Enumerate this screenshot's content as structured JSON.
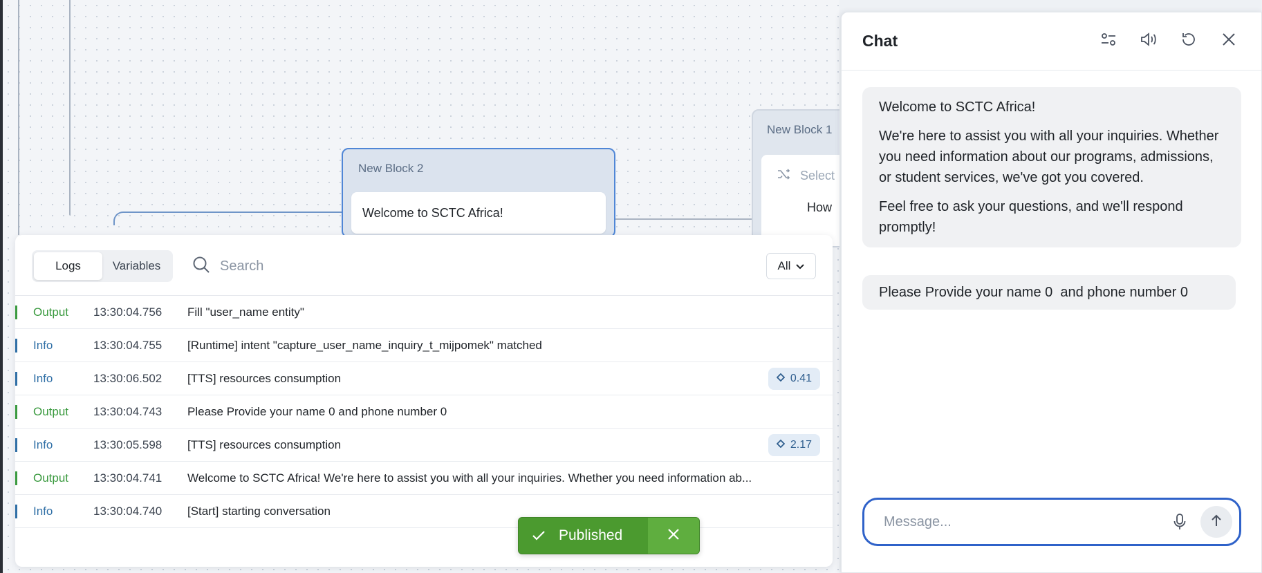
{
  "canvas": {
    "block2": {
      "title": "New Block 2",
      "message": "Welcome to SCTC Africa!"
    },
    "block1": {
      "title": "New Block 1",
      "select_placeholder": "Select",
      "message_start": "How"
    }
  },
  "logs": {
    "tabs": [
      {
        "label": "Logs"
      },
      {
        "label": "Variables"
      }
    ],
    "search_placeholder": "Search",
    "filter_value": "All",
    "rows": [
      {
        "level": "Output",
        "time": "13:30:04.756",
        "message": "Fill \"user_name entity\"",
        "badge": ""
      },
      {
        "level": "Info",
        "time": "13:30:04.755",
        "message": "[Runtime] intent \"capture_user_name_inquiry_t_mijpomek\" matched",
        "badge": ""
      },
      {
        "level": "Info",
        "time": "13:30:06.502",
        "message": "[TTS] resources consumption",
        "badge": "0.41"
      },
      {
        "level": "Output",
        "time": "13:30:04.743",
        "message": "Please Provide your name 0 and phone number 0",
        "badge": ""
      },
      {
        "level": "Info",
        "time": "13:30:05.598",
        "message": "[TTS] resources consumption",
        "badge": "2.17"
      },
      {
        "level": "Output",
        "time": "13:30:04.741",
        "message": "Welcome to SCTC Africa! We're here to assist you with all your inquiries. Whether you need information ab...",
        "badge": ""
      },
      {
        "level": "Info",
        "time": "13:30:04.740",
        "message": "[Start] starting conversation",
        "badge": ""
      }
    ],
    "colors": {
      "output": "#3a9a3f",
      "info": "#2f6fa6"
    }
  },
  "toast": {
    "label": "Published",
    "color": "#4b9a2f"
  },
  "chat": {
    "title": "Chat",
    "icons": [
      "settings-sliders-icon",
      "speaker-icon",
      "restart-icon",
      "close-icon"
    ],
    "messages": [
      {
        "paragraphs": [
          "Welcome to SCTC Africa!",
          "We're here to assist you with all your inquiries. Whether you need information about our programs, admissions, or student services, we've got you covered.",
          "Feel free to ask your questions, and we'll respond promptly!"
        ]
      },
      {
        "paragraphs": [
          "Please Provide your name 0  and phone number 0"
        ]
      }
    ],
    "composer_placeholder": "Message...",
    "accent": "#2f62c9"
  }
}
